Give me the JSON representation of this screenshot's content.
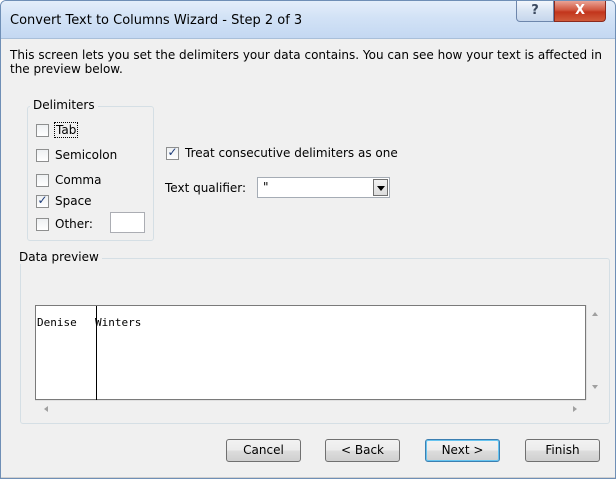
{
  "window": {
    "title": "Convert Text to Columns Wizard - Step 2 of 3",
    "help_label": "?",
    "close_label": "X"
  },
  "description": "This screen lets you set the delimiters your data contains.  You can see how your text is affected in the preview below.",
  "delimiters": {
    "group_label": "Delimiters",
    "items": [
      {
        "label": "Tab",
        "checked": false
      },
      {
        "label": "Semicolon",
        "checked": false
      },
      {
        "label": "Comma",
        "checked": false
      },
      {
        "label": "Space",
        "checked": true
      },
      {
        "label": "Other:",
        "checked": false
      }
    ],
    "other_value": ""
  },
  "options": {
    "consecutive_label": "Treat consecutive delimiters as one",
    "consecutive_checked": true,
    "qualifier_label": "Text qualifier:",
    "qualifier_value": "\""
  },
  "preview": {
    "group_label": "Data preview",
    "columns": [
      "Denise",
      "Winters"
    ]
  },
  "buttons": {
    "cancel": "Cancel",
    "back": "< Back",
    "next": "Next >",
    "finish": "Finish"
  },
  "colors": {
    "title_gradient_top": "#e4eefa",
    "close_red": "#c2351c",
    "dialog_bg": "#f0f0f0",
    "check_mark": "#1f3d7a"
  }
}
